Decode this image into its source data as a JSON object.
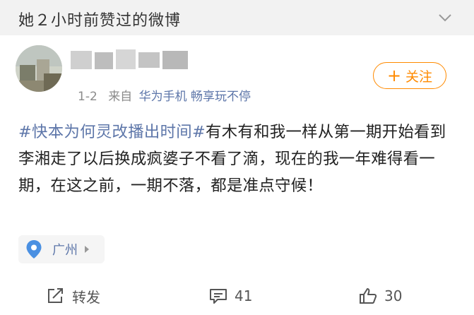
{
  "header": {
    "title": "她２小时前赞过的微博"
  },
  "post": {
    "time": "1-2",
    "source_label": "来自",
    "device": "华为手机 畅享玩不停",
    "follow_label": "关注",
    "topic": "#快本为何灵改播出时间#",
    "text": "有木有和我一样从第一期开始看到李湘走了以后换成疯婆子不看了滴，现在的我一年难得看一期，在这之前，一期不落，都是准点守候！",
    "location": "广州"
  },
  "actions": {
    "repost_label": "转发",
    "comment_count": "41",
    "like_count": "30"
  },
  "colors": {
    "accent_orange": "#ff8a00",
    "link_blue": "#5d76a9",
    "location_pin": "#4a90e2"
  }
}
